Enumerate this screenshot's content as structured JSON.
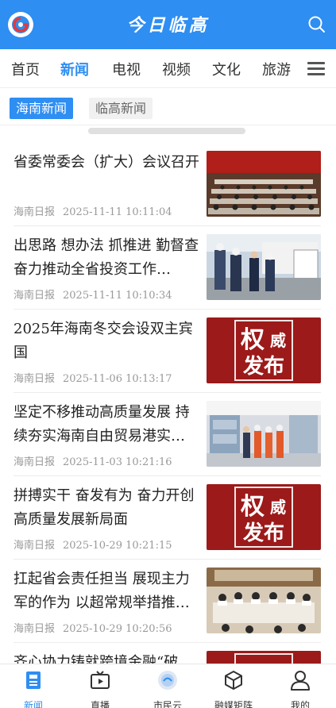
{
  "header": {
    "title": "今日临高"
  },
  "channels": [
    "首页",
    "新闻",
    "电视",
    "视频",
    "文化",
    "旅游"
  ],
  "active_channel": "新闻",
  "subtabs": [
    "海南新闻",
    "临高新闻"
  ],
  "news": [
    {
      "title": "省委常委会（扩大）会议召开",
      "source": "海南日报",
      "time": "2025-11-11 10:11:04"
    },
    {
      "title": "出思路 想办法 抓推进 勤督查 奋力推动全省投资工作…",
      "source": "海南日报",
      "time": "2025-11-11 10:10:34"
    },
    {
      "title": "2025年海南冬交会设双主宾国",
      "source": "海南日报",
      "time": "2025-11-06 10:13:17",
      "badge": [
        "权",
        "威",
        "发布"
      ]
    },
    {
      "title": "坚定不移推动高质量发展 持续夯实海南自由贸易港实…",
      "source": "海南日报",
      "time": "2025-11-03 10:21:16"
    },
    {
      "title": "拼搏实干 奋发有为 奋力开创高质量发展新局面",
      "source": "海南日报",
      "time": "2025-10-29 10:21:15",
      "badge": [
        "权",
        "威",
        "发布"
      ]
    },
    {
      "title": "扛起省会责任担当 展现主力军的作为 以超常规举措推…",
      "source": "海南日报",
      "time": "2025-10-29 10:20:56"
    },
    {
      "title": "齐心协力铸就跨境金融“破",
      "source": "",
      "time": ""
    }
  ],
  "bottom_nav": [
    "新闻",
    "直播",
    "市民云",
    "融媒矩阵",
    "我的"
  ],
  "colors": {
    "brand": "#2e8ef2",
    "badge_red": "#9c1a1a"
  }
}
